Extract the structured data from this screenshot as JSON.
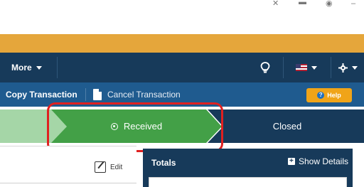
{
  "nav": {
    "more_label": "More"
  },
  "actions": {
    "copy_label": "Copy Transaction",
    "cancel_label": "Cancel Transaction",
    "help_label": "Help"
  },
  "status": {
    "received_label": "Received",
    "closed_label": "Closed"
  },
  "panel": {
    "edit_label": "Edit"
  },
  "totals": {
    "title": "Totals",
    "show_details_label": "Show Details"
  },
  "colors": {
    "orange_band": "#e5a63b",
    "nav_bg": "#173a5a",
    "action_bg": "#1f5b8f",
    "step_done": "#a5d6a7",
    "step_active": "#43a047",
    "step_next": "#173a5a",
    "highlight": "#e02020",
    "help_button": "#f0a418"
  },
  "icons": [
    "lightbulb-icon",
    "flag-icon",
    "gear-icon",
    "document-icon",
    "help-icon",
    "radio-icon",
    "edit-icon",
    "plus-icon"
  ]
}
